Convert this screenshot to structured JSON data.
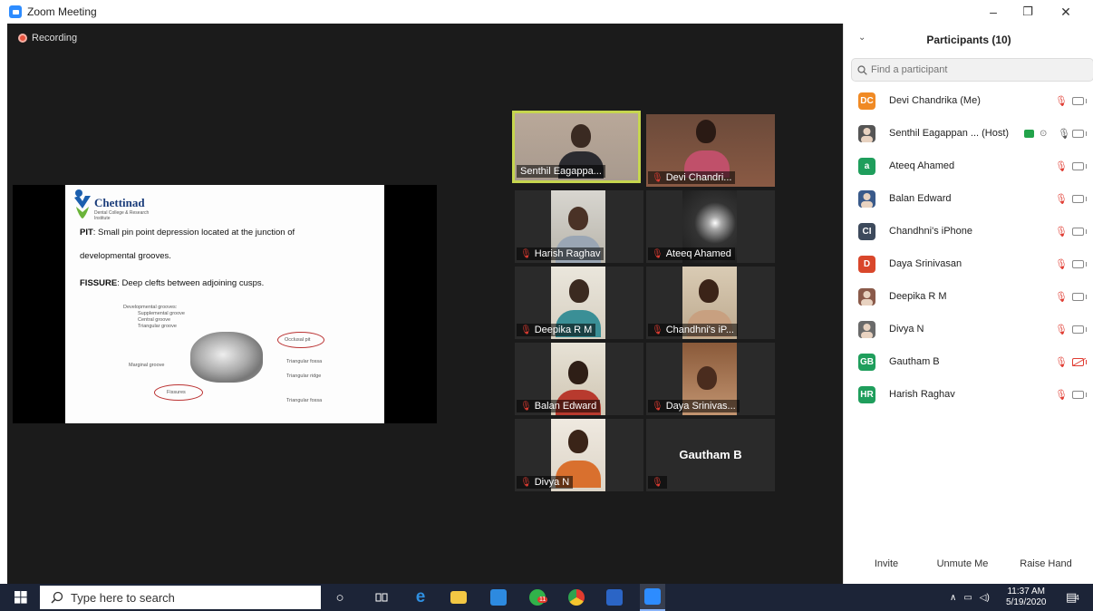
{
  "window": {
    "title": "Zoom Meeting",
    "controls": {
      "minimize": "–",
      "restore": "❐",
      "close": "✕"
    }
  },
  "recording": {
    "label": "Recording"
  },
  "slide": {
    "logo_name": "Chettinad",
    "logo_sub": "Dental College & Research Institute",
    "pit_term": "PIT",
    "pit_line1": ": Small pin point depression located at the junction of",
    "pit_line2": "developmental grooves.",
    "fissure_term": "FISSURE",
    "fissure_text": ": Deep clefts between adjoining cusps.",
    "diagram_labels": {
      "dev_grooves": "Developmental grooves:",
      "supplemental": "Supplemental groove",
      "central": "Central groove",
      "triangular_groove": "Triangular groove",
      "occlusal_pit": "Occlusal pit",
      "marginal": "Marginal groove",
      "triangular_fossa": "Triangular fossa",
      "triangular_ridge": "Triangular ridge",
      "fissures": "Fissures",
      "triangular_fossa2": "Triangular fossa"
    }
  },
  "tiles": [
    {
      "name": "Senthil Eagappa...",
      "muted": false
    },
    {
      "name": "Devi Chandri...",
      "muted": true
    },
    {
      "name": "Harish Raghav",
      "muted": true
    },
    {
      "name": "Ateeq Ahamed",
      "muted": true
    },
    {
      "name": "Deepika R M",
      "muted": true
    },
    {
      "name": "Chandhni's iP...",
      "muted": true
    },
    {
      "name": "Balan Edward",
      "muted": true
    },
    {
      "name": "Daya Srinivas...",
      "muted": true
    },
    {
      "name": "Divya N",
      "muted": true
    },
    {
      "name": "Gautham B",
      "muted": true
    }
  ],
  "panel": {
    "title": "Participants (10)",
    "search_placeholder": "Find a participant",
    "participants": [
      {
        "initials": "DC",
        "name": "Devi Chandrika (Me)",
        "color": "#f08a24"
      },
      {
        "initials": "",
        "name": "Senthil Eagappan ... (Host)",
        "color": "#555555"
      },
      {
        "initials": "a",
        "name": "Ateeq Ahamed",
        "color": "#1f9e5c"
      },
      {
        "initials": "",
        "name": "Balan Edward",
        "color": "#3a5a8a"
      },
      {
        "initials": "CI",
        "name": "Chandhni's iPhone",
        "color": "#3d4a5c"
      },
      {
        "initials": "D",
        "name": "Daya Srinivasan",
        "color": "#d9472b"
      },
      {
        "initials": "",
        "name": "Deepika R M",
        "color": "#8a5a4a"
      },
      {
        "initials": "",
        "name": "Divya N",
        "color": "#6a6a6a"
      },
      {
        "initials": "GB",
        "name": "Gautham B",
        "color": "#1f9e5c"
      },
      {
        "initials": "HR",
        "name": "Harish Raghav",
        "color": "#1f9e5c"
      }
    ],
    "buttons": {
      "invite": "Invite",
      "unmute": "Unmute Me",
      "raise_hand": "Raise Hand"
    }
  },
  "taskbar": {
    "search_placeholder": "Type here to search",
    "time": "11:37 AM",
    "date": "5/19/2020",
    "notification_count": "4",
    "badge_count": "11"
  },
  "colors": {
    "accent": "#2d8cff",
    "active_speaker": "#c6d64e",
    "mute_red": "#e03c32",
    "stage_bg": "#1b1b1b"
  }
}
